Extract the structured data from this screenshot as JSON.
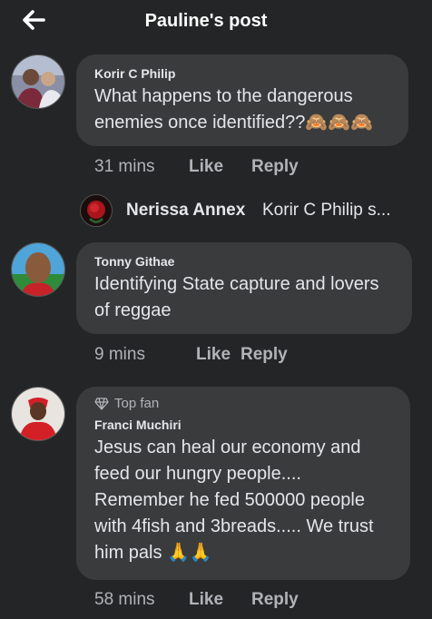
{
  "header": {
    "title": "Pauline's post",
    "back_icon": "arrow-left-icon"
  },
  "comments": [
    {
      "author": "Korir C Philip",
      "text": "What happens to the dangerous enemies once identified??🙈🙈🙈",
      "time": "31 mins",
      "like_label": "Like",
      "reply_label": "Reply"
    },
    {
      "author": "Tonny Githae",
      "text": "Identifying State capture and lovers of reggae",
      "time": "9 mins",
      "like_label": "Like",
      "reply_label": "Reply"
    },
    {
      "badge": "Top fan",
      "badge_icon": "diamond-icon",
      "author": "Franci Muchiri",
      "text": "Jesus can heal our economy and feed our hungry people.... Remember he fed 500000 people with 4fish and 3breads..... We trust him pals 🙏🙏",
      "time": "58 mins",
      "like_label": "Like",
      "reply_label": "Reply"
    }
  ],
  "reply_preview": {
    "name": "Nerissa Annex",
    "text": "Korir C Philip s..."
  },
  "colors": {
    "background": "#242526",
    "bubble": "#3a3b3c",
    "text": "#e4e6eb",
    "muted": "#b0b3b8"
  }
}
